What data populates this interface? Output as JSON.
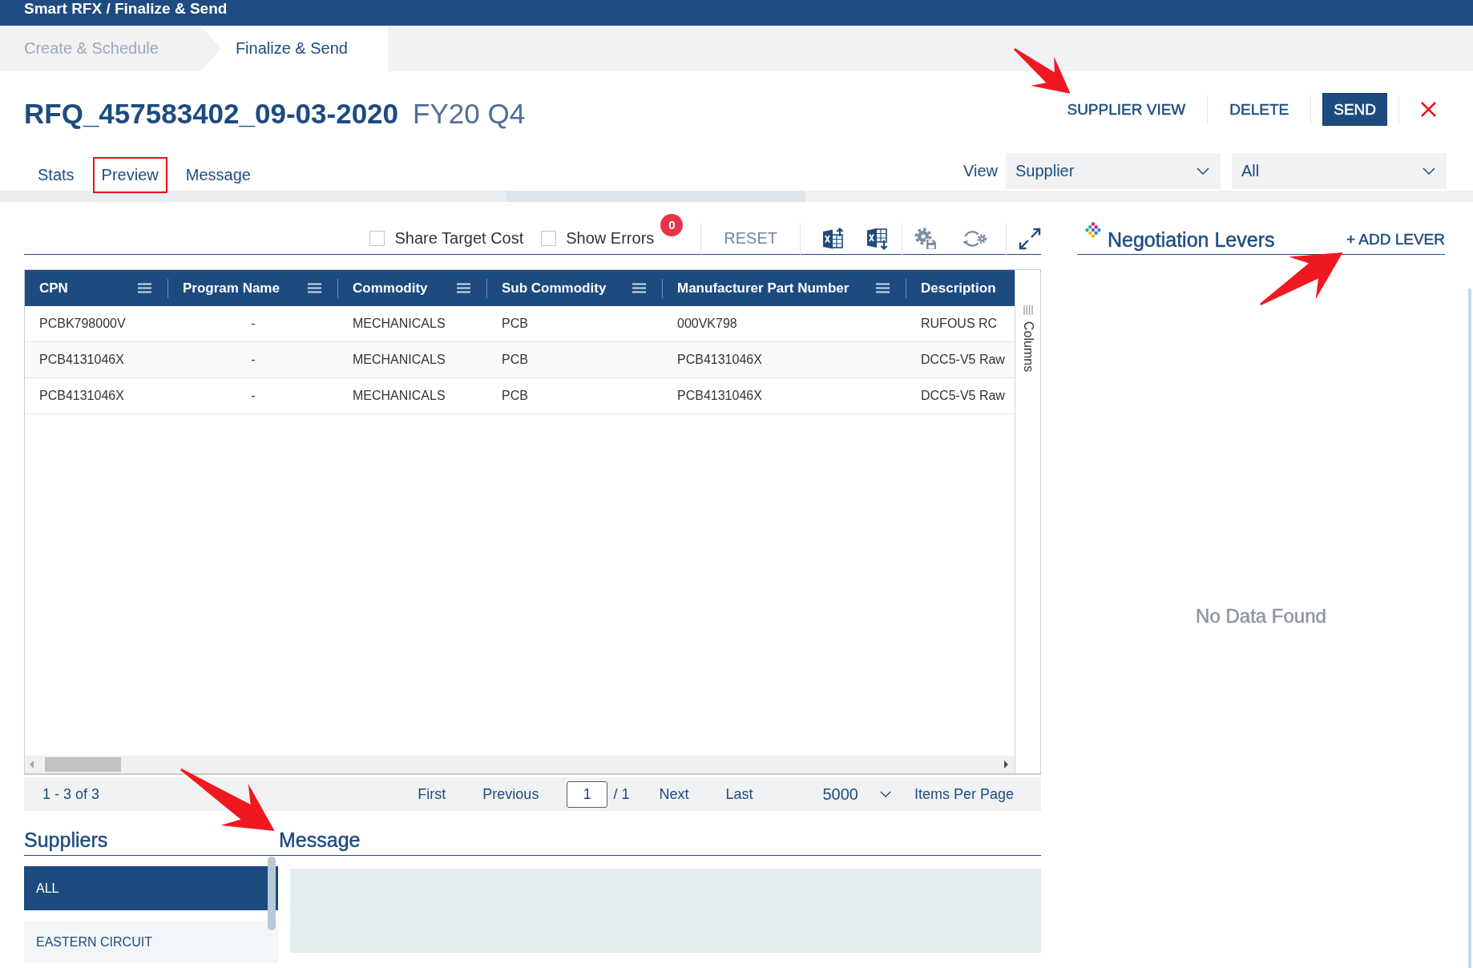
{
  "app_bar": {
    "title": "Smart RFX / Finalize & Send"
  },
  "steps": [
    {
      "label": "Create & Schedule",
      "selected": false
    },
    {
      "label": "Finalize & Send",
      "selected": true
    }
  ],
  "header": {
    "title": "RFQ_457583402_09-03-2020",
    "subtitle": "FY20 Q4",
    "actions": [
      {
        "kind": "link",
        "label": "SUPPLIER VIEW",
        "annotation_arrow": true
      },
      {
        "kind": "link",
        "label": "DELETE",
        "annotation_arrow": false
      },
      {
        "kind": "primary",
        "label": "SEND",
        "annotation_arrow": false
      },
      {
        "kind": "close",
        "annotation_arrow": false
      }
    ]
  },
  "tabs": [
    {
      "label": "Stats",
      "selected": false
    },
    {
      "label": "Preview",
      "selected": true
    },
    {
      "label": "Message",
      "selected": false
    }
  ],
  "view_filter": {
    "label": "View",
    "dropdowns": [
      {
        "value": "Supplier"
      },
      {
        "value": "All"
      }
    ]
  },
  "toolbar": {
    "checkboxes": [
      {
        "label": "Share Target Cost",
        "checked": false
      },
      {
        "label": "Show Errors",
        "checked": false,
        "badge": "0"
      }
    ],
    "reset": "RESET"
  },
  "table": {
    "columns": [
      {
        "label": "CPN",
        "menu": true
      },
      {
        "label": "Program Name",
        "menu": true
      },
      {
        "label": "Commodity",
        "menu": true
      },
      {
        "label": "Sub Commodity",
        "menu": true
      },
      {
        "label": "Manufacturer Part Number",
        "menu": true
      },
      {
        "label": "Description",
        "menu": false
      }
    ],
    "rows": [
      [
        "PCBK798000V",
        "-",
        "MECHANICALS",
        "PCB",
        "000VK798",
        "RUFOUS RC"
      ],
      [
        "PCB4131046X",
        "-",
        "MECHANICALS",
        "PCB",
        "PCB4131046X",
        "DCC5-V5 Raw"
      ],
      [
        "PCB4131046X",
        "-",
        "MECHANICALS",
        "PCB",
        "PCB4131046X",
        "DCC5-V5 Raw"
      ]
    ],
    "tool_panel": "Columns"
  },
  "pagination": {
    "summary": "1 - 3 of 3",
    "first": "First",
    "previous": "Previous",
    "page": "1",
    "page_total": "/ 1",
    "next": "Next",
    "last": "Last",
    "page_size": "5000",
    "page_size_label": "Items Per Page"
  },
  "suppliers": {
    "title": "Suppliers",
    "items": [
      {
        "label": "ALL",
        "selected": true
      },
      {
        "label": "EASTERN CIRCUIT",
        "selected": false
      }
    ]
  },
  "message": {
    "title": "Message",
    "annotation_arrow": true
  },
  "negotiation_levers": {
    "title": "Negotiation Levers",
    "add_button": "+ ADD LEVER",
    "annotation_arrow": true,
    "empty_text": "No Data Found"
  }
}
